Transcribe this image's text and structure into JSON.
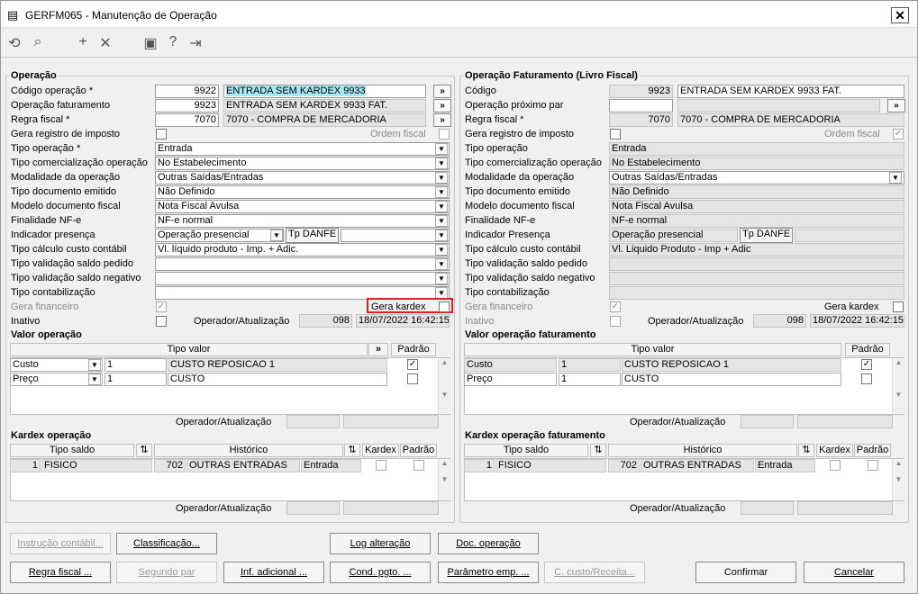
{
  "window": {
    "title": "GERFM065 - Manutenção de Operação",
    "close": "✕"
  },
  "toolbar": {
    "icons": [
      "⟲",
      "⌕",
      "+",
      "✕",
      "▣",
      "?",
      "⇥"
    ]
  },
  "left": {
    "title": "Operação",
    "labels": {
      "codigo": "Código operação *",
      "op_fat": "Operação faturamento",
      "regra": "Regra fiscal *",
      "gera_reg": "Gera registro de imposto",
      "ordem": "Ordem fiscal",
      "tipo_op": "Tipo operação *",
      "tipo_com": "Tipo comercialização operação",
      "modal": "Modalidade da operação",
      "tipo_doc": "Tipo documento emitido",
      "modelo": "Modelo documento fiscal",
      "finalidade": "Finalidade NF-e",
      "indicador": "Indicador presença",
      "custo": "Tipo cálculo custo contábil",
      "val_ped": "Tipo validação saldo pedido",
      "val_neg": "Tipo validação saldo negativo",
      "contab": "Tipo contabilização",
      "gera_fin": "Gera financeiro",
      "gera_kardex": "Gera kardex",
      "inativo": "Inativo",
      "operador": "Operador/Atualização"
    },
    "values": {
      "codigo": "9922",
      "codigo_desc": "ENTRADA SEM KARDEX 9933",
      "op_fat": "9923",
      "op_fat_desc": "ENTRADA SEM KARDEX 9933 FAT.",
      "regra": "7070",
      "regra_desc": "7070 - COMPRA DE MERCADORIA",
      "tipo_op": "Entrada",
      "tipo_com": "No Estabelecimento",
      "modal": "Outras Saídas/Entradas",
      "tipo_doc": "Não Definido",
      "modelo": "Nota Fiscal Avulsa",
      "finalidade": "NF-e normal",
      "indicador": "Operação presencial",
      "tp_danfe": "Tp DANFE",
      "custo": "Vl. líquido produto - Imp. + Adic.",
      "operador": "098",
      "atualizacao": "18/07/2022 16:42:15",
      "go": "»"
    }
  },
  "right": {
    "title": "Operação Faturamento (Livro Fiscal)",
    "labels": {
      "codigo": "Código",
      "prox": "Operação próximo par",
      "regra": "Regra fiscal *",
      "gera_reg": "Gera registro de imposto",
      "ordem": "Ordem fiscal",
      "tipo_op": "Tipo operação",
      "tipo_com": "Tipo comercialização operação",
      "modal": "Modalidade da operação",
      "tipo_doc": "Tipo documento emitido",
      "modelo": "Modelo documento fiscal",
      "finalidade": "Finalidade NF-e",
      "indicador": "Indicador Presença",
      "custo": "Tipo cálculo custo contábil",
      "val_ped": "Tipo validação saldo pedido",
      "val_neg": "Tipo validação saldo negativo",
      "contab": "Tipo contabilização",
      "gera_fin": "Gera financeiro",
      "gera_kardex": "Gera kardex",
      "inativo": "Inativo",
      "operador": "Operador/Atualização"
    },
    "values": {
      "codigo": "9923",
      "codigo_desc": "ENTRADA SEM KARDEX 9933 FAT.",
      "regra": "7070",
      "regra_desc": "7070 - COMPRA DE MERCADORIA",
      "tipo_op": "Entrada",
      "tipo_com": "No Estabelecimento",
      "modal": "Outras Saídas/Entradas",
      "tipo_doc": "Não Definido",
      "modelo": "Nota Fiscal Avulsa",
      "finalidade": "NF-e normal",
      "indicador": "Operação presencial",
      "tp_danfe": "Tp DANFE",
      "custo": "Vl. Liquido Produto - Imp + Adic",
      "operador": "098",
      "atualizacao": "18/07/2022 16:42:15",
      "go": "»"
    }
  },
  "valor_left": {
    "title": "Valor operação",
    "col_tipo": "Tipo valor",
    "col_padrao": "Padrão",
    "go": "»",
    "rows": [
      {
        "tipo": "Custo",
        "qtd": "1",
        "desc": "CUSTO REPOSICAO 1",
        "padrao": "✓"
      },
      {
        "tipo": "Preço",
        "qtd": "1",
        "desc": "CUSTO",
        "padrao": ""
      }
    ],
    "operador": "Operador/Atualização"
  },
  "valor_right": {
    "title": "Valor operação faturamento",
    "col_tipo": "Tipo valor",
    "col_padrao": "Padrão",
    "rows": [
      {
        "tipo": "Custo",
        "qtd": "1",
        "desc": "CUSTO REPOSICAO 1",
        "padrao": "✓"
      },
      {
        "tipo": "Preço",
        "qtd": "1",
        "desc": "CUSTO",
        "padrao": ""
      }
    ],
    "operador": "Operador/Atualização"
  },
  "kardex_left": {
    "title": "Kardex operação",
    "cols": {
      "tipo": "Tipo saldo",
      "hist": "Histórico",
      "kardex": "Kardex",
      "padrao": "Padrão"
    },
    "row": {
      "cod": "1",
      "tipo": "FISICO",
      "hcod": "702",
      "hist": "OUTRAS ENTRADAS",
      "mov": "Entrada"
    },
    "operador": "Operador/Atualização"
  },
  "kardex_right": {
    "title": "Kardex operação faturamento",
    "cols": {
      "tipo": "Tipo saldo",
      "hist": "Histórico",
      "kardex": "Kardex",
      "padrao": "Padrão"
    },
    "row": {
      "cod": "1",
      "tipo": "FISICO",
      "hcod": "702",
      "hist": "OUTRAS ENTRADAS",
      "mov": "Entrada"
    },
    "operador": "Operador/Atualização"
  },
  "buttons": {
    "instrucao": "Instrução contábil...",
    "classificacao": "Classificação...",
    "log": "Log alteração",
    "doc": "Doc. operação",
    "regra": "Regra fiscal ...",
    "segundo": "Segundo par",
    "inf": "Inf. adicional ...",
    "cond": "Cond. pgto. ...",
    "parametro": "Parâmetro emp. ...",
    "ccusto": "C. custo/Receita...",
    "confirmar": "Confirmar",
    "cancelar": "Cancelar"
  }
}
